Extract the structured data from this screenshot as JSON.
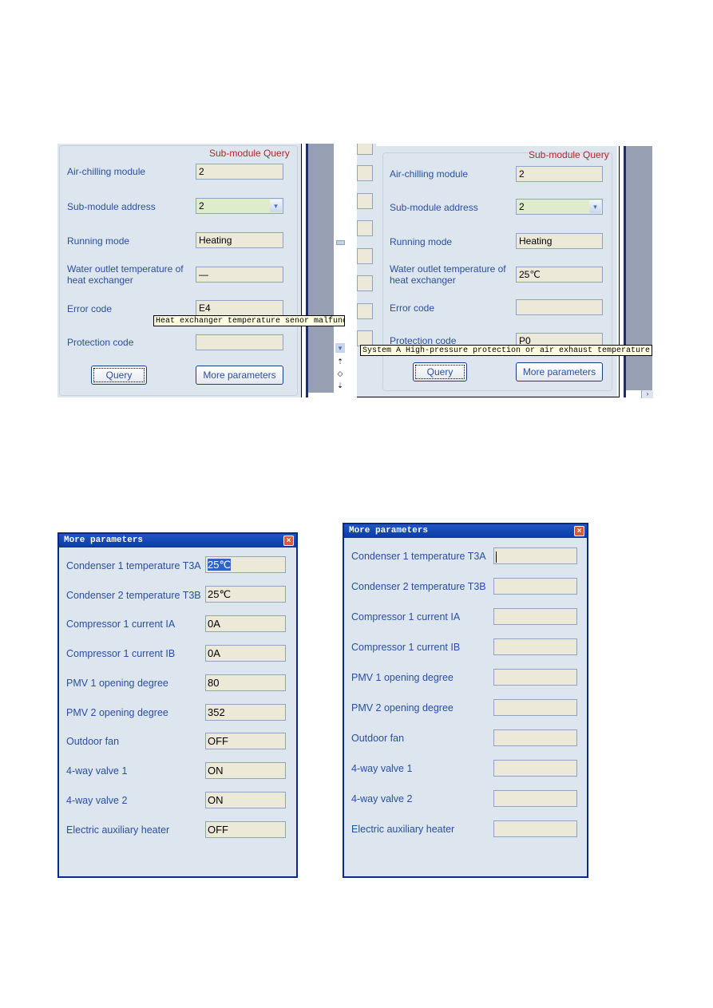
{
  "top_left": {
    "title": "Sub-module Query",
    "fields": [
      {
        "label": "Air-chilling module",
        "value": "2"
      },
      {
        "label": "Sub-module address",
        "value": "2"
      },
      {
        "label": "Running mode",
        "value": "Heating"
      },
      {
        "label": "Water outlet temperature of heat exchanger",
        "label_line1": "Water outlet temperature of",
        "label_line2": "heat exchanger",
        "value": "—"
      },
      {
        "label": "Error code",
        "value": "E4"
      },
      {
        "label": "Protection code",
        "value": ""
      }
    ],
    "tooltip": "Heat exchanger temperature senor malfunction",
    "query_label": "Query",
    "more_label": "More parameters"
  },
  "top_right": {
    "title": "Sub-module Query",
    "fields": [
      {
        "label": "Air-chilling module",
        "value": "2"
      },
      {
        "label": "Sub-module address",
        "value": "2"
      },
      {
        "label": "Running mode",
        "value": "Heating"
      },
      {
        "label": "Water outlet temperature of heat exchanger",
        "label_line1": "Water outlet temperature of",
        "label_line2": "heat exchanger",
        "value": "25℃"
      },
      {
        "label": "Error code",
        "value": ""
      },
      {
        "label": "Protection code",
        "value": "P0"
      }
    ],
    "tooltip": "System A High-pressure protection or air exhaust temperature protection",
    "query_label": "Query",
    "more_label": "More parameters"
  },
  "dialog_left": {
    "title": "More parameters",
    "close_icon": "×",
    "rows": [
      {
        "label": "Condenser 1 temperature T3A",
        "value": "25℃"
      },
      {
        "label": "Condenser 2 temperature T3B",
        "value": "25℃"
      },
      {
        "label": "Compressor 1 current IA",
        "value": "0A"
      },
      {
        "label": "Compressor 1 current IB",
        "value": "0A"
      },
      {
        "label": "PMV 1 opening degree",
        "value": "80"
      },
      {
        "label": "PMV 2 opening degree",
        "value": "352"
      },
      {
        "label": "Outdoor fan",
        "value": "OFF"
      },
      {
        "label": "4-way valve 1",
        "value": "ON"
      },
      {
        "label": "4-way valve 2",
        "value": "ON"
      },
      {
        "label": "Electric auxiliary heater",
        "value": "OFF"
      }
    ]
  },
  "dialog_right": {
    "title": "More parameters",
    "close_icon": "×",
    "rows": [
      {
        "label": "Condenser 1 temperature T3A",
        "value": ""
      },
      {
        "label": "Condenser 2 temperature T3B",
        "value": ""
      },
      {
        "label": "Compressor 1 current IA",
        "value": ""
      },
      {
        "label": "Compressor 1 current IB",
        "value": ""
      },
      {
        "label": "PMV 1 opening degree",
        "value": ""
      },
      {
        "label": "PMV 2 opening degree",
        "value": ""
      },
      {
        "label": "Outdoor fan",
        "value": ""
      },
      {
        "label": "4-way valve 1",
        "value": ""
      },
      {
        "label": "4-way valve 2",
        "value": ""
      },
      {
        "label": "Electric auxiliary heater",
        "value": ""
      }
    ]
  },
  "icons": {
    "dropdown": "▾",
    "scroll_up": "⇡",
    "scroll_mid": "◇",
    "scroll_down": "⇣"
  }
}
